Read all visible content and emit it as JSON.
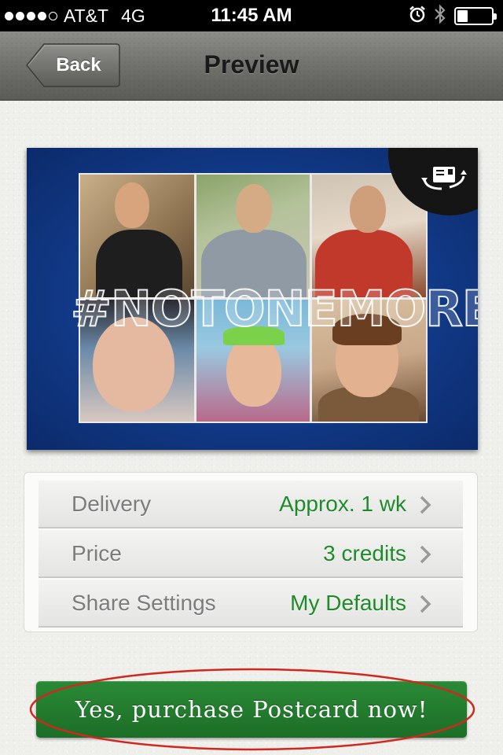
{
  "status_bar": {
    "carrier": "AT&T",
    "network": "4G",
    "time": "11:45 AM",
    "signal_bars": 4,
    "signal_max": 5,
    "battery_level": 0.3,
    "icons": [
      "alarm-clock-icon",
      "bluetooth-icon",
      "battery-icon"
    ]
  },
  "nav": {
    "back_label": "Back",
    "title": "Preview"
  },
  "postcard": {
    "hashtag": "#NOTONEMORE",
    "flip_icon": "postcard-flip-icon",
    "photo_count": 6
  },
  "options": [
    {
      "label": "Delivery",
      "value": "Approx. 1 wk"
    },
    {
      "label": "Price",
      "value": "3 credits"
    },
    {
      "label": "Share Settings",
      "value": "My Defaults"
    }
  ],
  "purchase": {
    "label": "Yes, purchase Postcard now!"
  },
  "colors": {
    "accent_green": "#1e8a2a",
    "button_green": "#237c2f",
    "postcard_blue": "#123a88",
    "highlight_red": "#d0281e"
  }
}
